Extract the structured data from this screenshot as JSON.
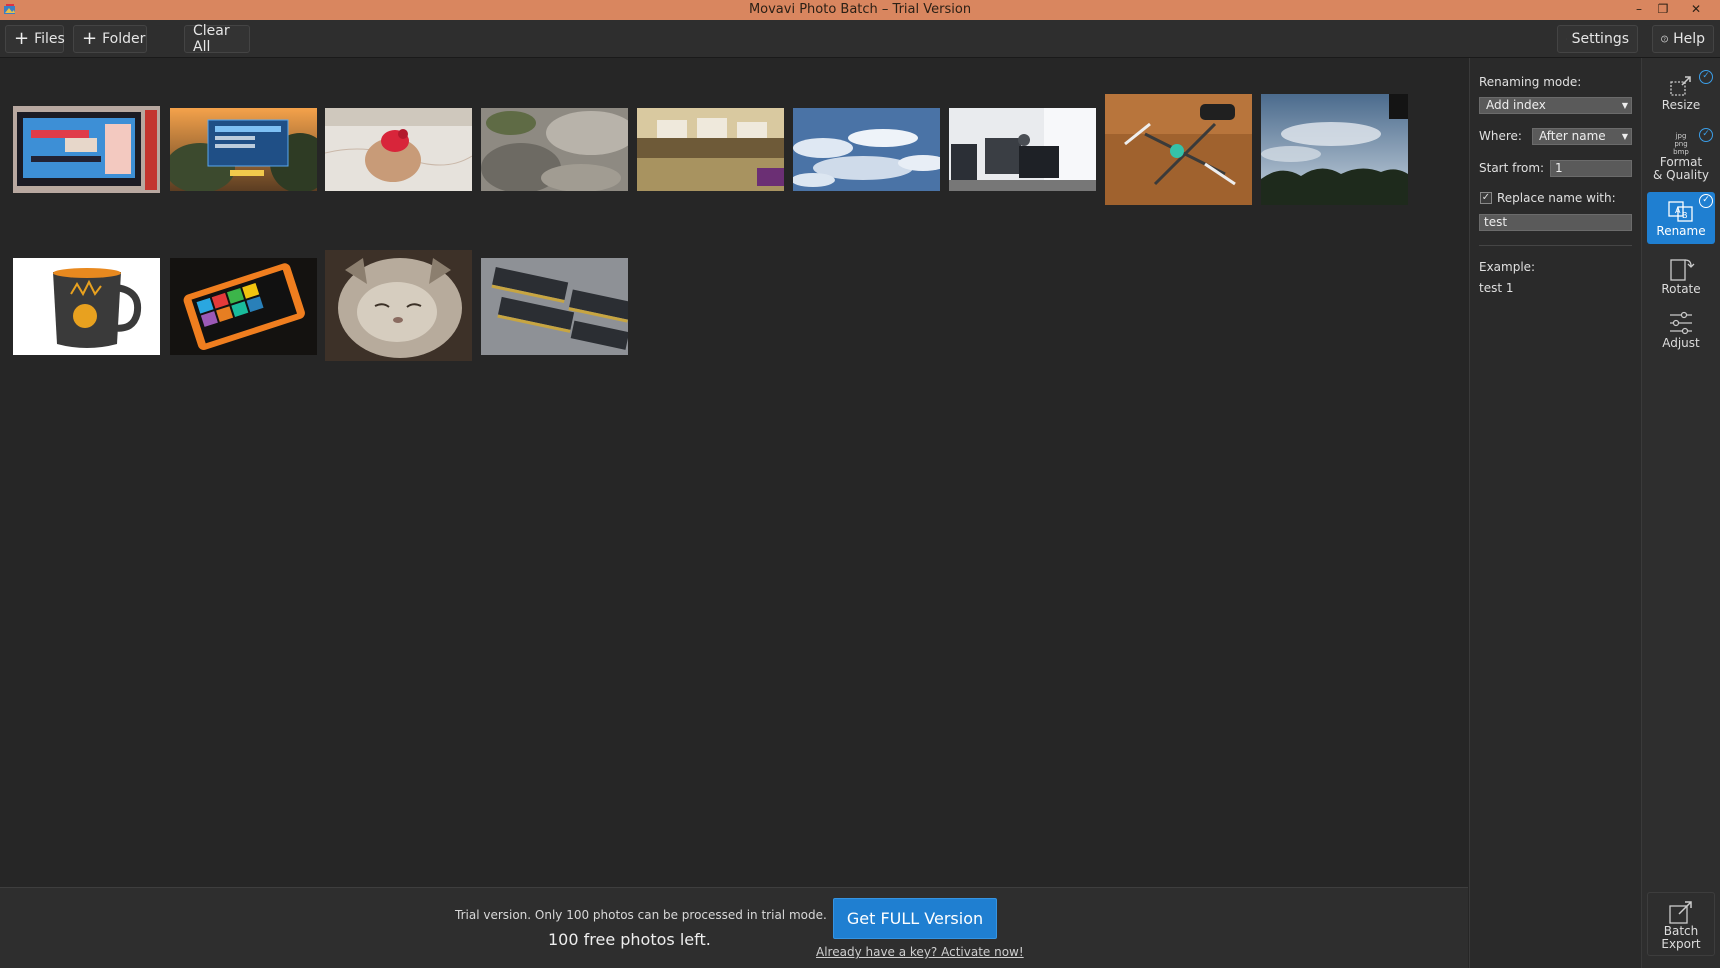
{
  "window": {
    "title": "Movavi Photo Batch – Trial Version",
    "minimize": "–",
    "restore": "❐",
    "close": "✕"
  },
  "toolbar": {
    "files_label": "Files",
    "folder_label": "Folder",
    "clear_all_label": "Clear All",
    "settings_label": "Settings",
    "help_label": "Help"
  },
  "panel": {
    "renaming_mode_label": "Renaming mode:",
    "renaming_mode_value": "Add index",
    "where_label": "Where:",
    "where_value": "After name",
    "start_from_label": "Start from:",
    "start_from_value": "1",
    "replace_name_label": "Replace name with:",
    "replace_name_checked": true,
    "replace_name_value": "test",
    "example_label": "Example:",
    "example_value": "test 1"
  },
  "tools": {
    "resize": "Resize",
    "format_line1": "Format",
    "format_line2": "& Quality",
    "rename": "Rename",
    "rotate": "Rotate",
    "adjust": "Adjust",
    "batch_line1": "Batch",
    "batch_line2": "Export",
    "format_icon_text": "jpg png bmp"
  },
  "bottom": {
    "trial_text": "Trial version. Only 100 photos can be processed in trial mode.",
    "free_left": "100 free photos left.",
    "get_full_label": "Get FULL Version",
    "activate_link": "Already have a key? Activate now!"
  },
  "thumbnails": [
    "tv-screen-photo",
    "desktop-app-photo",
    "towel-flower-photo",
    "rocks-photo",
    "restaurant-photo",
    "clouds-photo",
    "office-desk-photo",
    "drone-photo",
    "sky-trees-photo",
    "mug-photo",
    "phone-photo",
    "cat-photo",
    "ram-modules-photo"
  ],
  "colors": {
    "titlebar": "#d9865f",
    "accent": "#1f7fd1",
    "background": "#262626"
  }
}
